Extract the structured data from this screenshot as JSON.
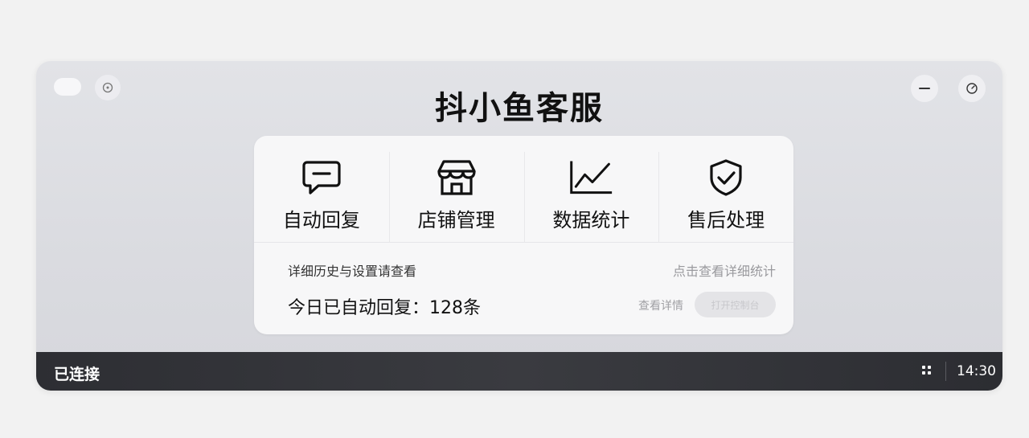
{
  "app": {
    "title": "抖小鱼客服"
  },
  "actions": [
    {
      "label": "自动回复",
      "icon": "chat-icon"
    },
    {
      "label": "店铺管理",
      "icon": "store-icon"
    },
    {
      "label": "数据统计",
      "icon": "chart-icon"
    },
    {
      "label": "售后处理",
      "icon": "shield-icon"
    }
  ],
  "info": {
    "left_text": "详细历史与设置请查看",
    "right_text": "点击查看详细统计",
    "stat_text": "今日已自动回复：128条",
    "link_text": "查看详情",
    "pill_button": "打开控制台"
  },
  "statusbar": {
    "status": "已连接",
    "time": "14:30"
  },
  "colors": {
    "window_bg": "#dcdde1",
    "card_bg": "#f7f7f8",
    "statusbar_bg": "#2f3035",
    "text_primary": "#111111"
  }
}
